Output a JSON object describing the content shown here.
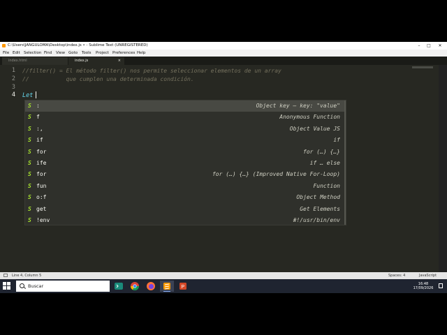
{
  "window": {
    "title": "C:\\Users\\JANGULOMA\\Desktop\\index.js • - Sublime Text (UNREGISTERED)",
    "controls": {
      "minimize": "–",
      "maximize": "□",
      "close": "✕"
    }
  },
  "menu": [
    "File",
    "Edit",
    "Selection",
    "Find",
    "View",
    "Goto",
    "Tools",
    "Project",
    "Preferences",
    "Help"
  ],
  "tabs": [
    {
      "label": "index.html",
      "active": false
    },
    {
      "label": "index.js",
      "active": true,
      "close": "×"
    }
  ],
  "editor": {
    "lines": [
      {
        "num": "1",
        "text": "//filter() = El método filter() nos permite seleccionar elementos de un array"
      },
      {
        "num": "2",
        "text": "//           que cumplen una determinada condición."
      },
      {
        "num": "3",
        "text": ""
      },
      {
        "num": "4",
        "text": "Let"
      }
    ],
    "colors": {
      "background": "#272822",
      "comment": "#75715e",
      "keyword": "#66d9ef"
    }
  },
  "autocomplete": {
    "items": [
      {
        "icon": "S",
        "trigger": ":",
        "desc": "Object key — key: \"value\"",
        "selected": true
      },
      {
        "icon": "S",
        "trigger": "f",
        "desc": "Anonymous Function"
      },
      {
        "icon": "S",
        "trigger": ":,",
        "desc": "Object Value JS"
      },
      {
        "icon": "S",
        "trigger": "if",
        "desc": "if"
      },
      {
        "icon": "S",
        "trigger": "for",
        "desc": "for (…) {…}"
      },
      {
        "icon": "S",
        "trigger": "ife",
        "desc": "if … else"
      },
      {
        "icon": "S",
        "trigger": "for",
        "desc": "for (…) {…} (Improved Native For-Loop)"
      },
      {
        "icon": "S",
        "trigger": "fun",
        "desc": "Function"
      },
      {
        "icon": "S",
        "trigger": "o:f",
        "desc": "Object Method"
      },
      {
        "icon": "S",
        "trigger": "get",
        "desc": "Get Elements"
      },
      {
        "icon": "S",
        "trigger": "!env",
        "desc": "#!/usr/bin/env"
      }
    ]
  },
  "status": {
    "position": "Line 4, Column 5",
    "spaces": "Spaces: 4",
    "syntax": "JavaScript"
  },
  "taskbar": {
    "search_placeholder": "Buscar",
    "apps": [
      {
        "name": "terminal-app",
        "color": "#1a8a7a"
      },
      {
        "name": "chrome-app",
        "color": "#4285f4"
      },
      {
        "name": "firefox-app",
        "color": "#ff7139"
      },
      {
        "name": "sublime-app",
        "color": "#ff9800",
        "active": true
      },
      {
        "name": "powerpoint-app",
        "color": "#d24726"
      }
    ],
    "time": "16:48",
    "date": "17/09/2026"
  }
}
